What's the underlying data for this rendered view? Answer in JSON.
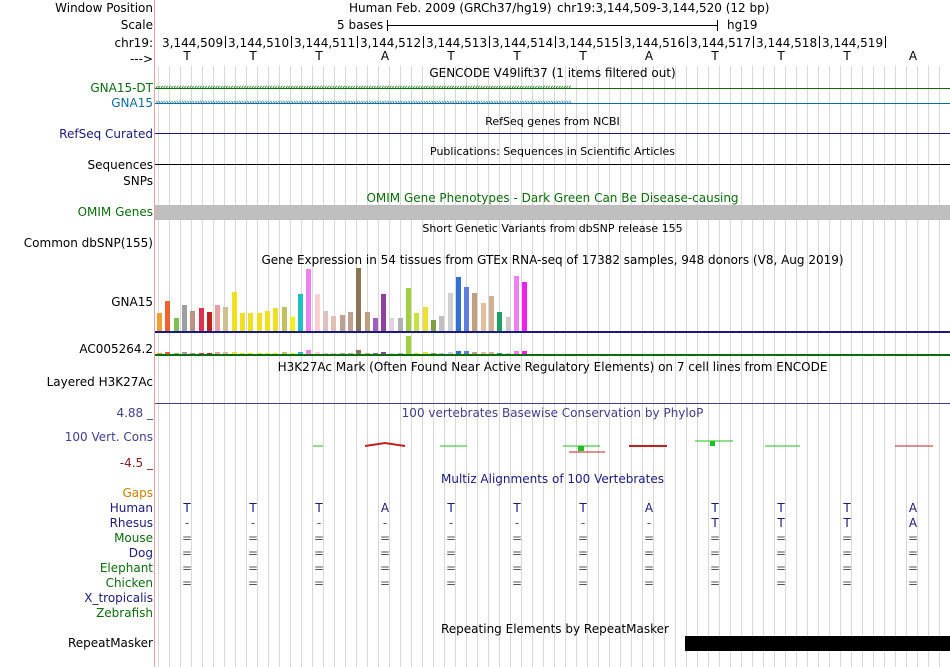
{
  "labels": {
    "window_position": "Window Position",
    "scale": "Scale",
    "chr": "chr19:",
    "strand": "--->",
    "gna15_dt": "GNA15-DT",
    "gna15": "GNA15",
    "refseq": "RefSeq Curated",
    "sequences": "Sequences",
    "snps": "SNPs",
    "omim": "OMIM Genes",
    "common_dbsnp": "Common dbSNP(155)",
    "gtex_gna15": "GNA15",
    "gtex_ac": "AC005264.2",
    "h3k27ac": "Layered H3K27Ac",
    "cons_max": "4.88 _",
    "cons": "100 Vert. Cons",
    "cons_min": "-4.5 _",
    "gaps": "Gaps",
    "human": "Human",
    "rhesus": "Rhesus",
    "mouse": "Mouse",
    "dog": "Dog",
    "elephant": "Elephant",
    "chicken": "Chicken",
    "xtrop": "X_tropicalis",
    "zebrafish": "Zebrafish",
    "repeatmasker": "RepeatMasker"
  },
  "header": {
    "assembly": "Human Feb. 2009 (GRCh37/hg19)",
    "position": "chr19:3,144,509-3,144,520 (12 bp)",
    "scale_text": "5 bases",
    "db": "hg19"
  },
  "ruler": [
    "3,144,509",
    "3,144,510",
    "3,144,511",
    "3,144,512",
    "3,144,513",
    "3,144,514",
    "3,144,515",
    "3,144,516",
    "3,144,517",
    "3,144,518",
    "3,144,519"
  ],
  "bases": [
    "T",
    "T",
    "T",
    "A",
    "T",
    "T",
    "T",
    "A",
    "T",
    "T",
    "T",
    "A"
  ],
  "tracks": {
    "gencode": "GENCODE V49lift37 (1 items filtered out)",
    "refseq": "RefSeq genes from NCBI",
    "pubs": "Publications: Sequences in Scientific Articles",
    "omim": "OMIM Gene Phenotypes - Dark Green Can Be Disease-causing",
    "dbsnp": "Short Genetic Variants from dbSNP release 155",
    "gtex": "Gene Expression in 54 tissues from GTEx RNA-seq of 17382 samples, 948 donors (V8, Aug 2019)",
    "h3k27ac": "H3K27Ac Mark (Often Found Near Active Regulatory Elements) on 7 cell lines from ENCODE",
    "phylop": "100 vertebrates Basewise Conservation by PhyloP",
    "multiz": "Multiz Alignments of 100 Vertebrates",
    "repeat": "Repeating Elements by RepeatMasker"
  },
  "alignment": {
    "human": [
      "T",
      "T",
      "T",
      "A",
      "T",
      "T",
      "T",
      "A",
      "T",
      "T",
      "T",
      "A"
    ],
    "rhesus": [
      "-",
      "-",
      "-",
      "-",
      "-",
      "-",
      "-",
      "-",
      "T",
      "T",
      "T",
      "A"
    ],
    "mouse": [
      "=",
      "=",
      "=",
      "=",
      "=",
      "=",
      "=",
      "=",
      "=",
      "=",
      "=",
      "="
    ],
    "dog": [
      "=",
      "=",
      "=",
      "=",
      "=",
      "=",
      "=",
      "=",
      "=",
      "=",
      "=",
      "="
    ],
    "elephant": [
      "=",
      "=",
      "=",
      "=",
      "=",
      "=",
      "=",
      "=",
      "=",
      "=",
      "=",
      "="
    ],
    "chicken": [
      "=",
      "=",
      "=",
      "=",
      "=",
      "=",
      "=",
      "=",
      "=",
      "=",
      "=",
      "="
    ]
  },
  "colors": {
    "gencode_green": "#0a6e0a",
    "gencode_blue": "#0c6ea0",
    "navy": "#1a1a80",
    "omim_green": "#0a6e0a",
    "phylop_blue": "#404090",
    "phylop_red": "#8b1a1a",
    "gaps_orange": "#d08000",
    "species_green": "#0a6e0a",
    "gtex_axis": "#1a1a80"
  },
  "gtex_colors": [
    "#f0a030",
    "#f06030",
    "#80c050",
    "#a0a0a0",
    "#c09080",
    "#e03050",
    "#c02020",
    "#e8a0a0",
    "#d0c090",
    "#f0e020",
    "#f0e020",
    "#f0e020",
    "#f0e020",
    "#f0e020",
    "#f0e020",
    "#c0c060",
    "#f0f020",
    "#20c0c0",
    "#f080f0",
    "#f8d0d0",
    "#e0c0c0",
    "#e0c0b0",
    "#c0a090",
    "#c0a090",
    "#8b7355",
    "#c0a080",
    "#a060c0",
    "#9040a0",
    "#e0d0e0",
    "#b0b0b0",
    "#a0d040",
    "#c8e040",
    "#f0e030",
    "#80a040",
    "#c0c0c0",
    "#d0d0d0",
    "#3070d0",
    "#6080e0",
    "#c0a080",
    "#e0c0a0",
    "#d0b090",
    "#20a060",
    "#d0c8c8",
    "#f080f0",
    "#f020f0"
  ],
  "gtex_values": [
    0.28,
    0.48,
    0.2,
    0.42,
    0.32,
    0.36,
    0.3,
    0.42,
    0.38,
    0.62,
    0.28,
    0.28,
    0.28,
    0.32,
    0.36,
    0.38,
    0.22,
    0.58,
    0.98,
    0.58,
    0.32,
    0.24,
    0.26,
    0.3,
    1.0,
    0.3,
    0.2,
    0.58,
    0.2,
    0.2,
    0.68,
    0.28,
    0.38,
    0.18,
    0.24,
    0.6,
    0.86,
    0.7,
    0.6,
    0.44,
    0.56,
    0.3,
    0.22,
    0.88,
    0.78
  ]
}
